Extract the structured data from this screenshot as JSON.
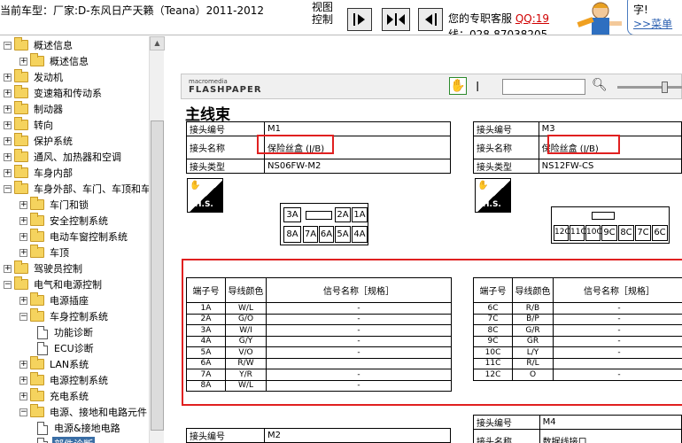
{
  "header": {
    "car_info": "当前车型：厂家:D-东风日产天籁（Teana）2011-2012",
    "view_control": "视图控制",
    "customer_service": "您的专职客服",
    "qq": "QQ:19",
    "phone": "线：028-87038205",
    "bubble_text": "字!",
    "bubble_link": ">>菜单"
  },
  "sidebar": {
    "items": [
      {
        "label": "概述信息",
        "type": "folder",
        "expanded": true,
        "level": 0
      },
      {
        "label": "概述信息",
        "type": "folder",
        "expanded": false,
        "level": 1
      },
      {
        "label": "发动机",
        "type": "folder",
        "expanded": false,
        "level": 0
      },
      {
        "label": "变速箱和传动系",
        "type": "folder",
        "expanded": false,
        "level": 0
      },
      {
        "label": "制动器",
        "type": "folder",
        "expanded": false,
        "level": 0
      },
      {
        "label": "转向",
        "type": "folder",
        "expanded": false,
        "level": 0
      },
      {
        "label": "保护系统",
        "type": "folder",
        "expanded": false,
        "level": 0
      },
      {
        "label": "通风、加热器和空调",
        "type": "folder",
        "expanded": false,
        "level": 0
      },
      {
        "label": "车身内部",
        "type": "folder",
        "expanded": false,
        "level": 0
      },
      {
        "label": "车身外部、车门、车顶和车",
        "type": "folder",
        "expanded": true,
        "level": 0
      },
      {
        "label": "车门和锁",
        "type": "folder",
        "expanded": false,
        "level": 1
      },
      {
        "label": "安全控制系统",
        "type": "folder",
        "expanded": false,
        "level": 1
      },
      {
        "label": "电动车窗控制系统",
        "type": "folder",
        "expanded": false,
        "level": 1
      },
      {
        "label": "车顶",
        "type": "folder",
        "expanded": false,
        "level": 1
      },
      {
        "label": "驾驶员控制",
        "type": "folder",
        "expanded": false,
        "level": 0
      },
      {
        "label": "电气和电源控制",
        "type": "folder",
        "expanded": true,
        "level": 0
      },
      {
        "label": "电源插座",
        "type": "folder",
        "expanded": false,
        "level": 1
      },
      {
        "label": "车身控制系统",
        "type": "folder",
        "expanded": true,
        "level": 1
      },
      {
        "label": "功能诊断",
        "type": "doc",
        "level": 2
      },
      {
        "label": "ECU诊断",
        "type": "doc",
        "level": 2
      },
      {
        "label": "LAN系统",
        "type": "folder",
        "expanded": false,
        "level": 1
      },
      {
        "label": "电源控制系统",
        "type": "folder",
        "expanded": false,
        "level": 1
      },
      {
        "label": "充电系统",
        "type": "folder",
        "expanded": false,
        "level": 1
      },
      {
        "label": "电源、接地和电路元件",
        "type": "folder",
        "expanded": true,
        "level": 1
      },
      {
        "label": "电源&接地电路",
        "type": "doc",
        "level": 2
      },
      {
        "label": "部件诊断",
        "type": "doc",
        "level": 2,
        "selected": true
      }
    ]
  },
  "flashpaper": {
    "logo_top": "macromedia",
    "logo_bottom": "FLASHPAPER"
  },
  "page": {
    "title": "主线束",
    "connector_left": {
      "rows": [
        {
          "label": "接头编号",
          "value": "M1"
        },
        {
          "label": "接头名称",
          "value": "保险丝盒 (J/B)"
        },
        {
          "label": "接头类型",
          "value": "NS06FW-M2"
        }
      ],
      "pins_top": [
        "3A",
        "",
        "2A",
        "1A"
      ],
      "pins_bottom": [
        "8A",
        "7A",
        "6A",
        "5A",
        "4A"
      ],
      "table_headers": [
        "端子号",
        "导线颜色",
        "信号名称［规格］"
      ],
      "table_rows": [
        [
          "1A",
          "W/L",
          "-"
        ],
        [
          "2A",
          "G/O",
          "-"
        ],
        [
          "3A",
          "W/I",
          "-"
        ],
        [
          "4A",
          "G/Y",
          "-"
        ],
        [
          "5A",
          "V/O",
          "-"
        ],
        [
          "6A",
          "R/W",
          ""
        ],
        [
          "7A",
          "Y/R",
          "-"
        ],
        [
          "8A",
          "W/L",
          "-"
        ]
      ]
    },
    "connector_right": {
      "rows": [
        {
          "label": "接头编号",
          "value": "M3"
        },
        {
          "label": "接头名称",
          "value": "保险丝盒 (J/B)"
        },
        {
          "label": "接头类型",
          "value": "NS12FW-CS"
        }
      ],
      "pins": [
        "12C",
        "11C",
        "10C",
        "9C",
        "8C",
        "7C",
        "6C"
      ],
      "table_headers": [
        "端子号",
        "导线颜色",
        "信号名称［规格］"
      ],
      "table_rows": [
        [
          "6C",
          "R/B",
          "-"
        ],
        [
          "7C",
          "B/P",
          "-"
        ],
        [
          "8C",
          "G/R",
          "-"
        ],
        [
          "9C",
          "GR",
          "-"
        ],
        [
          "10C",
          "L/Y",
          "-"
        ],
        [
          "11C",
          "R/L",
          ""
        ],
        [
          "12C",
          "O",
          "-"
        ]
      ]
    },
    "bottom_left": {
      "label": "接头编号",
      "value": "M2"
    },
    "bottom_right": [
      {
        "label": "接头编号",
        "value": "M4"
      },
      {
        "label": "接头名称",
        "value": "数据线接口"
      }
    ],
    "hs_label": "H.S."
  },
  "colors": {
    "highlight": "#e02020",
    "selection": "#3a6ea5"
  }
}
